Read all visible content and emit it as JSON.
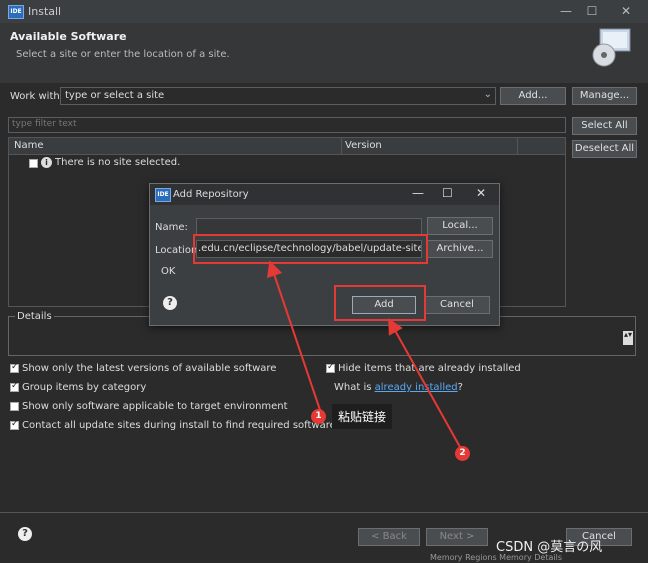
{
  "window": {
    "title": "Install",
    "min": "—",
    "max": "☐",
    "close": "✕"
  },
  "header": {
    "title": "Available Software",
    "subtitle": "Select a site or enter the location of a site."
  },
  "work_with": {
    "label": "Work with:",
    "placeholder": "type or select a site",
    "add": "Add...",
    "manage": "Manage..."
  },
  "filter": {
    "placeholder": "type filter text",
    "select_all": "Select All",
    "deselect_all": "Deselect All"
  },
  "table": {
    "col_name": "Name",
    "col_version": "Version",
    "empty": "There is no site selected."
  },
  "details": {
    "label": "Details"
  },
  "options": [
    {
      "label": "Show only the latest versions of available software",
      "checked": true
    },
    {
      "label": "Group items by category",
      "checked": true
    },
    {
      "label": "Show only software applicable to target environment",
      "checked": false
    },
    {
      "label": "Contact all update sites during install to find required software",
      "checked": true
    }
  ],
  "right_options": {
    "hide_installed": "Hide items that are already installed",
    "what_is": "What is",
    "already_installed": "already installed",
    "qmark": "?"
  },
  "footer": {
    "back": "< Back",
    "next": "Next >",
    "cancel": "Cancel"
  },
  "dialog": {
    "title": "Add Repository",
    "name_label": "Name:",
    "location_label": "Location:",
    "location_value": ".edu.cn/eclipse/technology/babel/update-site/latest/",
    "local": "Local...",
    "archive": "Archive...",
    "ok_text": "OK",
    "add": "Add",
    "cancel": "Cancel"
  },
  "annotations": {
    "badge1": "1",
    "badge2": "2",
    "callout": "粘贴链接"
  },
  "watermark": "CSDN @莫言の风",
  "bottom_tabs": "Memory Regions   Memory Details",
  "colors": {
    "accent_red": "#e53935",
    "link": "#5aa9f5"
  },
  "icons": [
    "ide-icon",
    "cd-icon",
    "info-icon",
    "help-icon",
    "dropdown-icon"
  ]
}
